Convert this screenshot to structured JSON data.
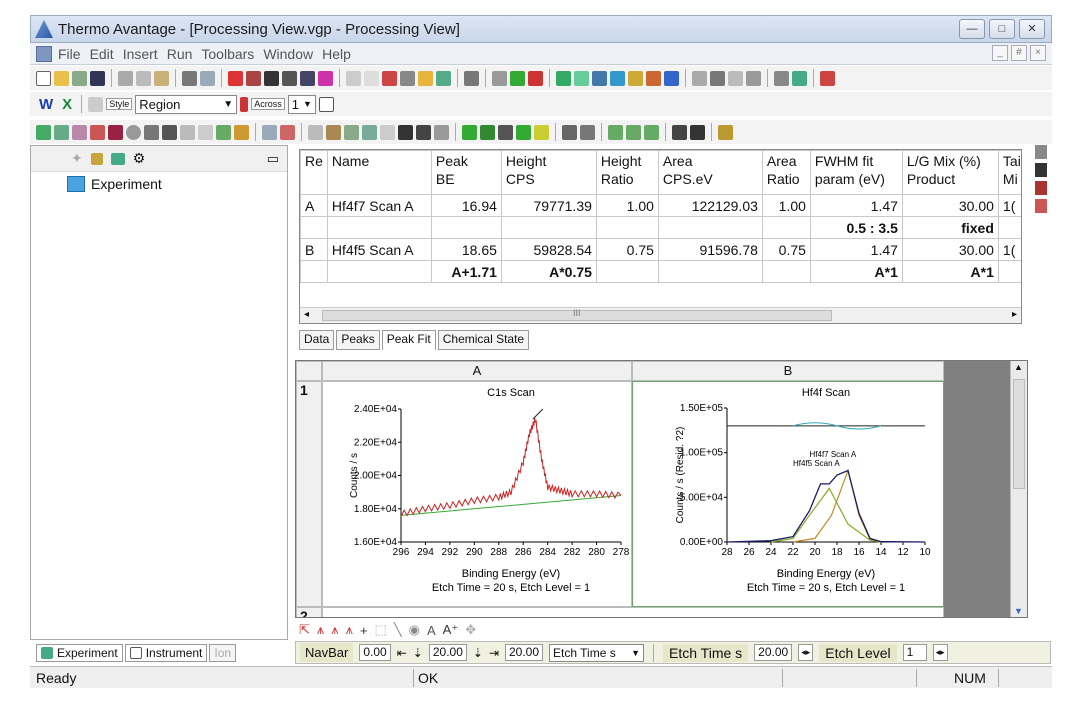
{
  "window": {
    "title": "Thermo Avantage - [Processing View.vgp - Processing View]",
    "buttons": [
      "—",
      "□",
      "✕"
    ]
  },
  "menu": {
    "items": [
      "File",
      "Edit",
      "Insert",
      "Run",
      "Toolbars",
      "Window",
      "Help"
    ],
    "mdi_buttons": [
      "_",
      "#",
      "×"
    ]
  },
  "toolbar2": {
    "w_label": "W",
    "x_label": "X",
    "style_label": "Style",
    "style_value": "Region",
    "across_label": "Across",
    "across_value": "1"
  },
  "left_panel": {
    "tree_root": "Experiment",
    "tabs": [
      "Experiment",
      "Instrument",
      "Ion"
    ]
  },
  "peak_table": {
    "headers": [
      "Re",
      "Name",
      "Peak\nBE",
      "Height\nCPS",
      "Height\nRatio",
      "Area\nCPS.eV",
      "Area\nRatio",
      "FWHM fit\nparam (eV)",
      "L/G Mix (%)\nProduct",
      "Tai\nMi"
    ],
    "rows": [
      [
        "A",
        "Hf4f7 Scan A",
        "16.94",
        "79771.39",
        "1.00",
        "122129.03",
        "1.00",
        "1.47",
        "30.00",
        "1("
      ],
      [
        "",
        "",
        "",
        "",
        "",
        "",
        "",
        "0.5 : 3.5",
        "fixed",
        ""
      ],
      [
        "B",
        "Hf4f5 Scan A",
        "18.65",
        "59828.54",
        "0.75",
        "91596.78",
        "0.75",
        "1.47",
        "30.00",
        "1("
      ],
      [
        "",
        "",
        "A+1.71",
        "A*0.75",
        "",
        "",
        "",
        "A*1",
        "A*1",
        ""
      ]
    ],
    "scroll_mark": "III"
  },
  "view_tabs": [
    "Data",
    "Peaks",
    "Peak Fit",
    "Chemical State"
  ],
  "grid": {
    "col_a": "A",
    "col_b": "B",
    "row_1": "1",
    "row_2": "2"
  },
  "chart_data": [
    {
      "type": "line",
      "title": "C1s Scan",
      "xlabel": "Binding Energy (eV)",
      "ylabel": "Counts / s",
      "footer": "Etch Time = 20 s, Etch Level = 1",
      "x_ticks": [
        "296",
        "294",
        "292",
        "290",
        "288",
        "286",
        "284",
        "282",
        "280",
        "278"
      ],
      "y_ticks": [
        "1.60E+04",
        "1.80E+04",
        "2.00E+04",
        "2.20E+04",
        "2.40E+04"
      ],
      "xlim": [
        296,
        278
      ],
      "ylim": [
        16000,
        24000
      ],
      "series": [
        {
          "x": [
            296,
            294,
            292,
            290,
            288,
            287,
            286,
            285.5,
            285,
            284.5,
            284,
            283,
            282,
            280,
            278
          ],
          "values": [
            17700,
            18000,
            18200,
            18500,
            18700,
            19000,
            20800,
            22500,
            23400,
            21000,
            19300,
            19100,
            18900,
            18900,
            18800
          ]
        }
      ],
      "colors": {
        "data": "#cc2222",
        "background": "#33aa33"
      }
    },
    {
      "type": "line",
      "title": "Hf4f Scan",
      "xlabel": "Binding Energy (eV)",
      "ylabel": "Counts / s  (Resid. ?2)",
      "footer": "Etch Time = 20 s, Etch Level = 1",
      "x_ticks": [
        "28",
        "26",
        "24",
        "22",
        "20",
        "18",
        "16",
        "14",
        "12",
        "10"
      ],
      "y_ticks": [
        "0.00E+00",
        "5.00E+04",
        "1.00E+05",
        "1.50E+05"
      ],
      "xlim": [
        28,
        10
      ],
      "ylim": [
        0,
        150000
      ],
      "annotations": [
        "Hf4f7 Scan A",
        "Hf4f5 Scan A"
      ],
      "series": [
        {
          "name": "Hf4f7 Scan A",
          "x": [
            22,
            20,
            18.5,
            17,
            16,
            15,
            14
          ],
          "values": [
            0,
            4000,
            30000,
            80000,
            30000,
            3000,
            0
          ]
        },
        {
          "name": "Hf4f5 Scan A",
          "x": [
            24,
            22,
            20.5,
            18.7,
            17,
            15,
            14
          ],
          "values": [
            0,
            4000,
            30000,
            60000,
            20000,
            2000,
            0
          ]
        }
      ],
      "colors": {
        "envelope": "#1a1a66",
        "peak1": "#cc8822",
        "peak2": "#88aa22"
      }
    }
  ],
  "drawbar": {
    "text_tool": "A"
  },
  "navbar": {
    "label": "NavBar",
    "v1": "0.00",
    "v2": "20.00",
    "v3": "20.00",
    "etch_select": "Etch Time s",
    "etch_time_label": "Etch Time s",
    "etch_time_value": "20.00",
    "etch_level_label": "Etch Level",
    "etch_level_value": "1"
  },
  "status": {
    "ready": "Ready",
    "ok": "OK",
    "num": "NUM"
  }
}
